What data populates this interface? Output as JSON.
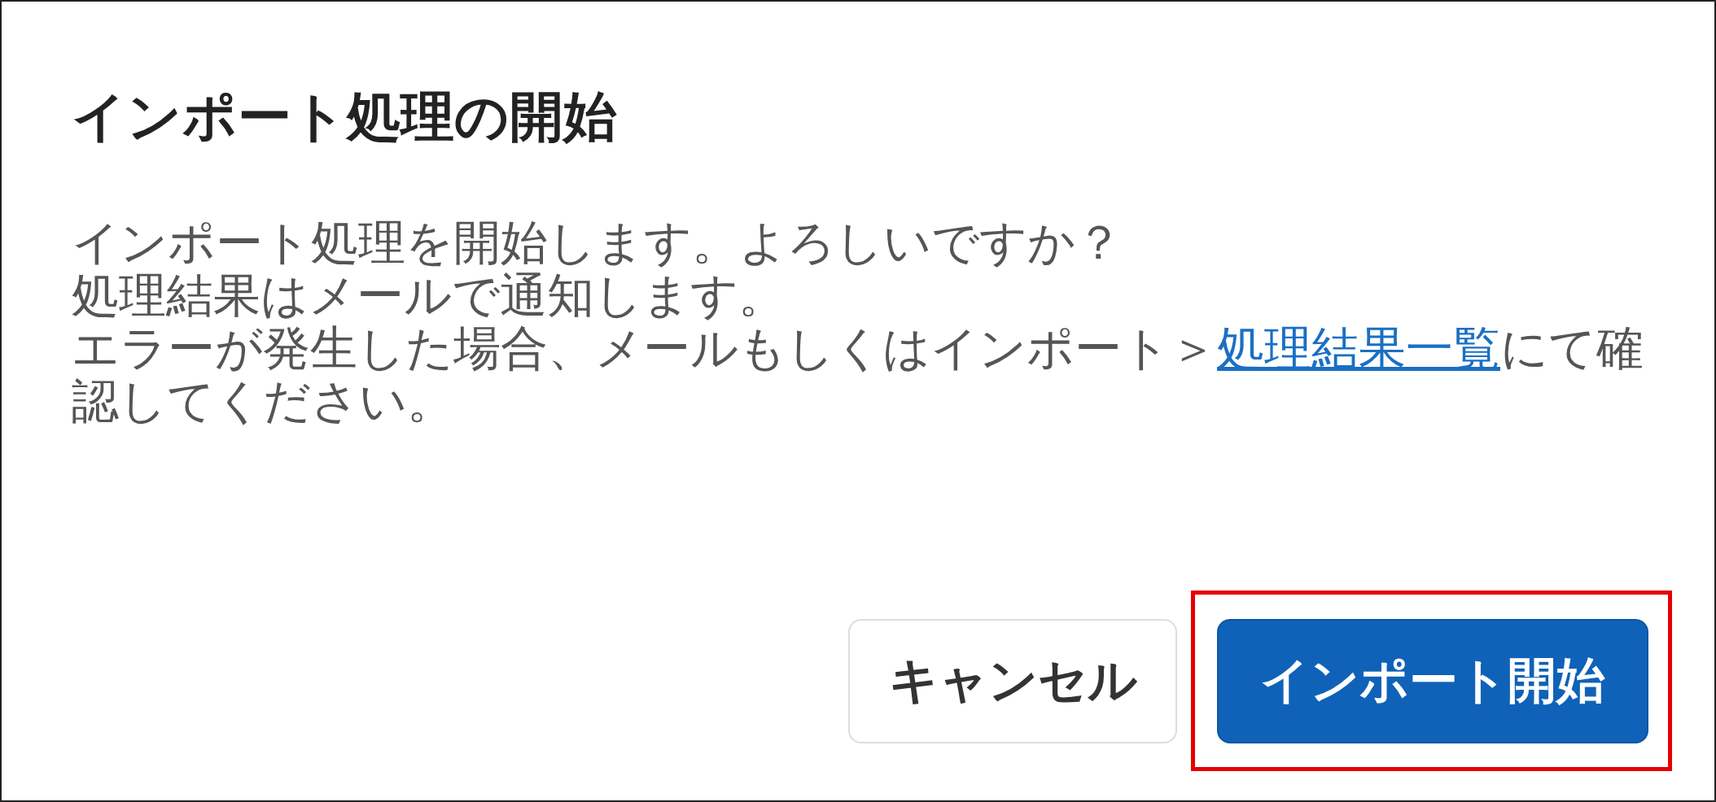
{
  "dialog": {
    "title": "インポート処理の開始",
    "message_lines": [
      "インポート処理を開始します。よろしいですか？",
      "処理結果はメールで通知します。"
    ],
    "note": {
      "before": "エラーが発生した場合、メールもしくはインポート＞",
      "link": "処理結果一覧",
      "after": "にて確認してください。"
    },
    "buttons": [
      {
        "label": "キャンセル",
        "kind": "secondary",
        "highlighted": false
      },
      {
        "label": "インポート開始",
        "kind": "primary",
        "highlighted": true
      }
    ]
  }
}
